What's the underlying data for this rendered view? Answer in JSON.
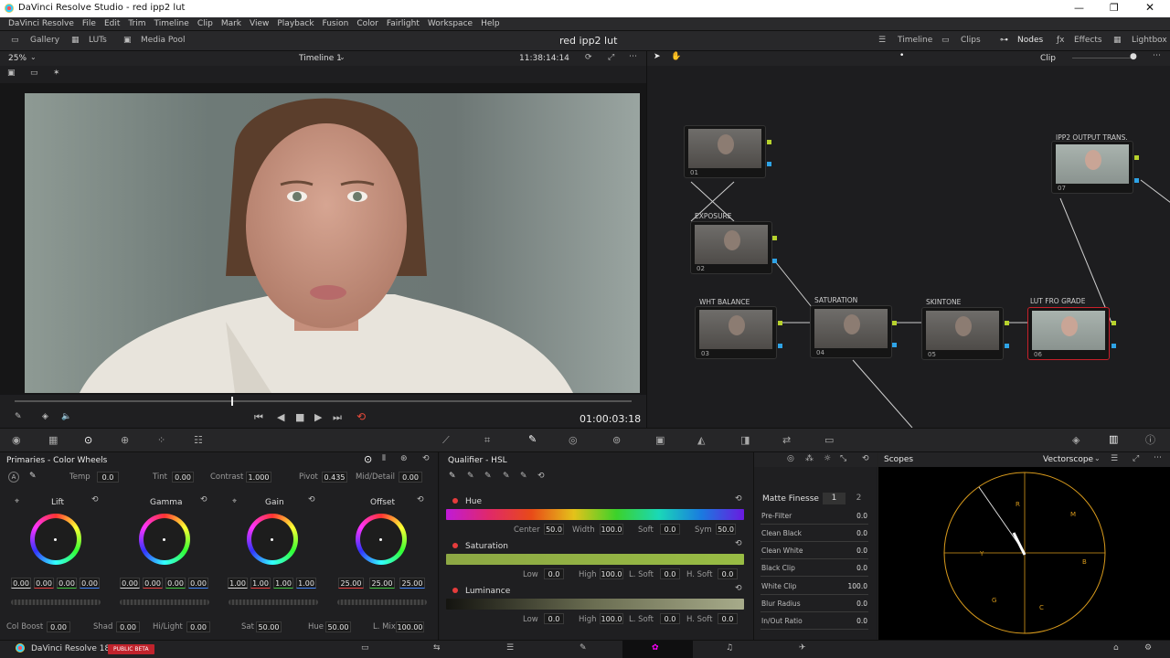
{
  "window": {
    "title": "DaVinci Resolve Studio - red ipp2 lut"
  },
  "menu": [
    "DaVinci Resolve",
    "File",
    "Edit",
    "Trim",
    "Timeline",
    "Clip",
    "Mark",
    "View",
    "Playback",
    "Fusion",
    "Color",
    "Fairlight",
    "Workspace",
    "Help"
  ],
  "toolbar": {
    "gallery": "Gallery",
    "luts": "LUTs",
    "media_pool": "Media Pool",
    "project_title": "red ipp2 lut",
    "timeline": "Timeline",
    "clips": "Clips",
    "nodes": "Nodes",
    "effects": "Effects",
    "lightbox": "Lightbox"
  },
  "viewer": {
    "zoom": "25%",
    "timeline_name": "Timeline 1",
    "source_tc": "11:38:14:14",
    "timecode": "01:00:03:18"
  },
  "nodes_panel": {
    "mode": "Clip"
  },
  "nodes": [
    {
      "num": "01",
      "label": ""
    },
    {
      "num": "02",
      "label": "EXPOSURE"
    },
    {
      "num": "03",
      "label": "WHT BALANCE"
    },
    {
      "num": "04",
      "label": "SATURATION"
    },
    {
      "num": "05",
      "label": "SKINTONE"
    },
    {
      "num": "06",
      "label": "LUT FRO GRADE"
    },
    {
      "num": "07",
      "label": "IPP2 OUTPUT TRANS."
    }
  ],
  "primaries": {
    "title": "Primaries - Color Wheels",
    "temp_label": "Temp",
    "temp": "0.0",
    "tint_label": "Tint",
    "tint": "0.00",
    "contrast_label": "Contrast",
    "contrast": "1.000",
    "pivot_label": "Pivot",
    "pivot": "0.435",
    "middetail_label": "Mid/Detail",
    "middetail": "0.00",
    "wheels": [
      {
        "name": "Lift",
        "values": [
          "0.00",
          "0.00",
          "0.00",
          "0.00"
        ]
      },
      {
        "name": "Gamma",
        "values": [
          "0.00",
          "0.00",
          "0.00",
          "0.00"
        ]
      },
      {
        "name": "Gain",
        "values": [
          "1.00",
          "1.00",
          "1.00",
          "1.00"
        ]
      },
      {
        "name": "Offset",
        "values": [
          "25.00",
          "25.00",
          "25.00"
        ]
      }
    ],
    "colboost_label": "Col Boost",
    "colboost": "0.00",
    "shad_label": "Shad",
    "shad": "0.00",
    "hilight_label": "Hi/Light",
    "hilight": "0.00",
    "sat_label": "Sat",
    "sat": "50.00",
    "hue_label": "Hue",
    "hue": "50.00",
    "lmix_label": "L. Mix",
    "lmix": "100.00"
  },
  "qualifier": {
    "title": "Qualifier - HSL",
    "hue": {
      "label": "Hue",
      "center_label": "Center",
      "center": "50.0",
      "width_label": "Width",
      "width": "100.0",
      "soft_label": "Soft",
      "soft": "0.0",
      "sym_label": "Sym",
      "sym": "50.0"
    },
    "saturation": {
      "label": "Saturation",
      "low_label": "Low",
      "low": "0.0",
      "high_label": "High",
      "high": "100.0",
      "lsoft_label": "L. Soft",
      "lsoft": "0.0",
      "hsoft_label": "H. Soft",
      "hsoft": "0.0"
    },
    "luminance": {
      "label": "Luminance",
      "low_label": "Low",
      "low": "0.0",
      "high_label": "High",
      "high": "100.0",
      "lsoft_label": "L. Soft",
      "lsoft": "0.0",
      "hsoft_label": "H. Soft",
      "hsoft": "0.0"
    }
  },
  "matte_finesse": {
    "title": "Matte Finesse",
    "tab1": "1",
    "tab2": "2",
    "rows": [
      {
        "label": "Pre-Filter",
        "value": "0.0"
      },
      {
        "label": "Clean Black",
        "value": "0.0"
      },
      {
        "label": "Clean White",
        "value": "0.0"
      },
      {
        "label": "Black Clip",
        "value": "0.0"
      },
      {
        "label": "White Clip",
        "value": "100.0"
      },
      {
        "label": "Blur Radius",
        "value": "0.0"
      },
      {
        "label": "In/Out Ratio",
        "value": "0.0"
      }
    ]
  },
  "scopes": {
    "title": "Scopes",
    "mode": "Vectorscope",
    "targets": [
      "R",
      "M",
      "B",
      "C",
      "G",
      "Y"
    ]
  },
  "footer": {
    "app": "DaVinci Resolve 18",
    "badge": "PUBLIC BETA"
  },
  "colors": {
    "accent_red": "#e63c3c",
    "node_select": "#c8202a",
    "port_green": "#b7d22d",
    "port_blue": "#2ea3e6",
    "scope_gold": "#d89a1c"
  }
}
